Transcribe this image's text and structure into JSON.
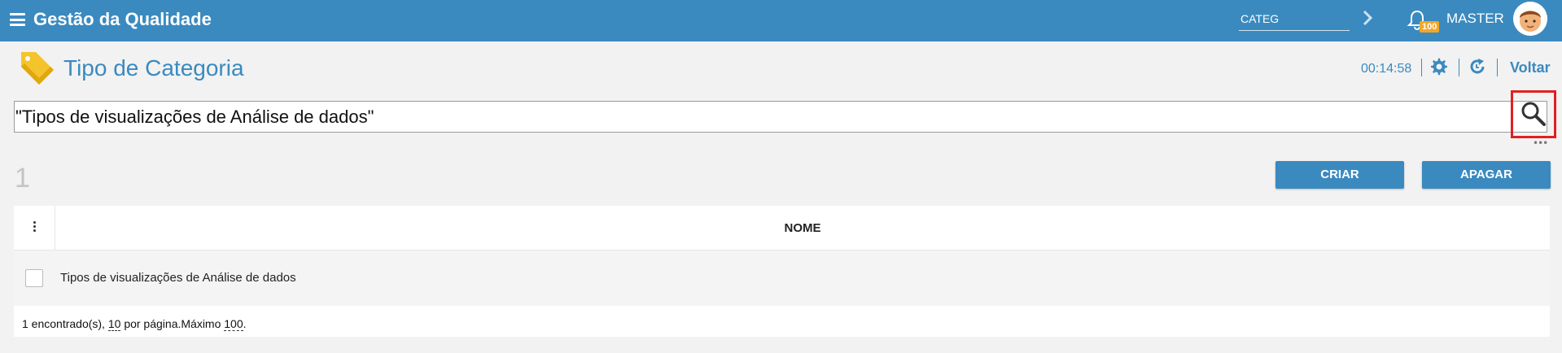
{
  "app": {
    "title": "Gestão da Qualidade",
    "search_value": "CATEG",
    "notification_count": "100",
    "user_name": "MASTER",
    "accent_color": "#3a8ac0"
  },
  "page": {
    "title": "Tipo de Categoria",
    "timer": "00:14:58",
    "back_label": "Voltar",
    "icons": [
      "tag-icon",
      "gear-icon",
      "refresh-icon"
    ]
  },
  "search": {
    "value": "\"Tipos de visualizações de Análise de dados\""
  },
  "results": {
    "count": "1",
    "create_label": "CRIAR",
    "delete_label": "APAGAR"
  },
  "table": {
    "columns": [
      "NOME"
    ],
    "rows": [
      {
        "nome": "Tipos de visualizações de Análise de dados"
      }
    ],
    "footer": {
      "found_text": "1 encontrado(s),",
      "per_page": "10",
      "per_page_text": "por página.Máximo",
      "max": "100",
      "end": "."
    }
  }
}
